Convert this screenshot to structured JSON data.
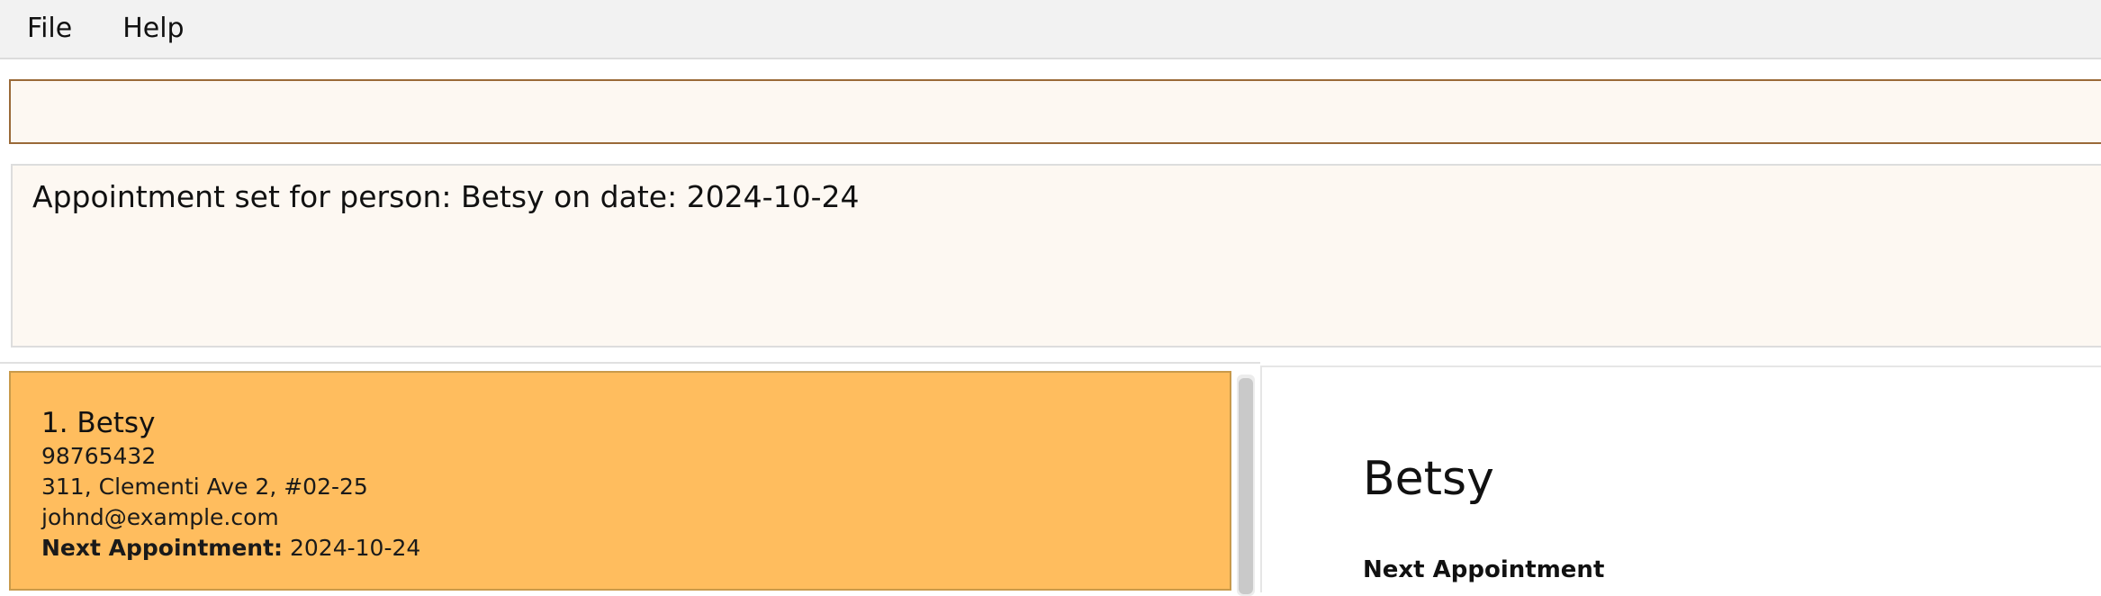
{
  "menu": {
    "items": [
      "File",
      "Help"
    ]
  },
  "command_box": {
    "value": "",
    "placeholder": ""
  },
  "result": {
    "message": "Appointment set for person: Betsy on date: 2024-10-24"
  },
  "person_list": [
    {
      "index_name": "1. Betsy",
      "phone": "98765432",
      "address": "311, Clementi Ave 2, #02-25",
      "email": "johnd@example.com",
      "appointment_label": "Next Appointment:",
      "appointment_value": "2024-10-24"
    }
  ],
  "detail": {
    "name": "Betsy",
    "appointment_heading": "Next Appointment"
  },
  "colors": {
    "selected_card": "#ffbd5e",
    "command_border": "#9a6a38",
    "panel_bg": "#fdf8f2"
  }
}
